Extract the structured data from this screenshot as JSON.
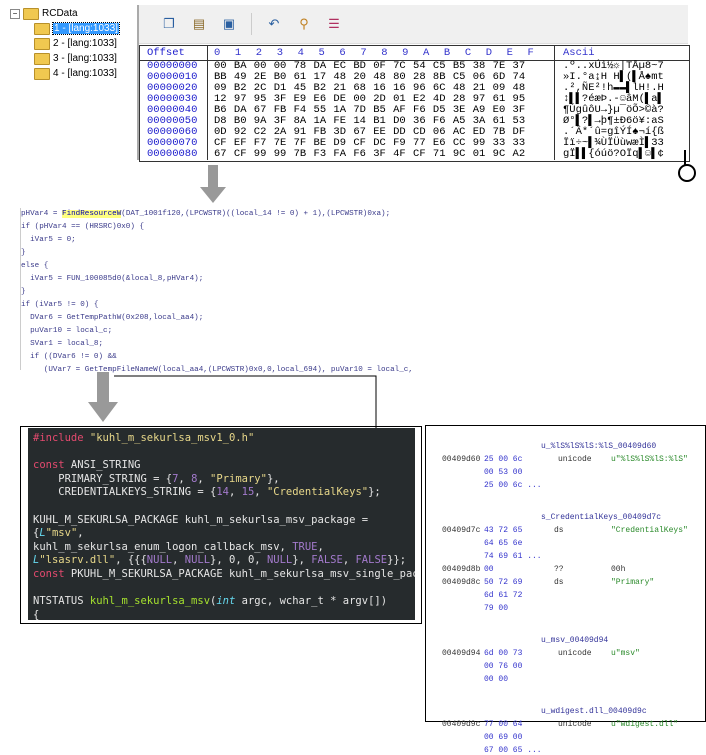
{
  "tree": {
    "root": "RCData",
    "items": [
      "1 - [lang:1033]",
      "2 - [lang:1033]",
      "3 - [lang:1033]",
      "4 - [lang:1033]"
    ],
    "selected": 0
  },
  "toolbar": {
    "icons": [
      "copy-icon",
      "paste-icon",
      "export-icon",
      "undo-icon",
      "find-icon",
      "hex-settings-icon"
    ]
  },
  "hex": {
    "header": {
      "offset": "Offset",
      "cols": "0  1  2  3  4  5  6  7  8  9  A  B  C  D  E  F",
      "ascii": "Ascii"
    },
    "rows": [
      {
        "off": "00000000",
        "hex": "00 BA 00 00 78 DA EC BD 0F 7C 54 C5 B5 38 7E 37",
        "ascii": ".º..xÚì½☼|TÅµ8~7"
      },
      {
        "off": "00000010",
        "hex": "BB 49 2E B0 61 17 48 20 48 80 28 8B C5 06 6D 74",
        "ascii": "»I.°a↨H H▌(▌Å♠mt"
      },
      {
        "off": "00000020",
        "hex": "09 B2 2C D1 45 B2 21 68 16 16 96 6C 48 21 09 48",
        "ascii": ".²,ÑE²!h▬▬▌lH!.H"
      },
      {
        "off": "00000030",
        "hex": "12 97 95 3F E9 E6 DE 00 2D 01 E2 4D 28 97 61 95",
        "ascii": "↕▌▌?éæÞ.-☺âM(▌a▌"
      },
      {
        "off": "00000040",
        "hex": "B6 DA 67 FB F4 55 1A 7D B5 AF F6 D5 3E A9 E0 3F",
        "ascii": "¶ÚgûôU→}µ¯öÕ>©à?"
      },
      {
        "off": "00000050",
        "hex": "D8 B0 9A 3F 8A 1A FE 14 B1 D0 36 F6 A5 3A 61 53",
        "ascii": "Ø°▌?▌→þ¶±Ð6ö¥:aS"
      },
      {
        "off": "00000060",
        "hex": "0D 92 C2 2A 91 FB 3D 67 EE DD CD 06 AC ED 7B DF",
        "ascii": ".´Â*´û=gîÝÍ♠¬í{ß"
      },
      {
        "off": "00000070",
        "hex": "CF EF F7 7E 7F BE D9 CF DC F9 77 E6 CC 99 33 33",
        "ascii": "Ïï÷~▌¾ÙÏÜùwæÌ▌33"
      },
      {
        "off": "00000080",
        "hex": "67 CF 99 99 7B F3 FA F6 3F 4F CF 71 9C 01 9C A2",
        "ascii": "gÏ▌▌{óúö?OÏq▌☺▌¢"
      }
    ]
  },
  "decompiled": [
    "pHVar4 = FindResourceW(DAT_1001f120,(LPCWSTR)((local_14 != 0) + 1),(LPCWSTR)0xa);",
    "if (pHVar4 == (HRSRC)0x0) {",
    "  iVar5 = 0;",
    "}",
    "else {",
    "  iVar5 = FUN_100085d0(&local_8,pHVar4);",
    "}",
    "if (iVar5 != 0) {",
    "  DVar6 = GetTempPathW(0x208,local_aa4);",
    "  puVar10 = local_c;",
    "  SVar1 = local_8;",
    "  if ((DVar6 != 0) &&",
    "     (UVar7 = GetTempFileNameW(local_aa4,(LPCWSTR)0x0,0,local_694), puVar10 = local_c,"
  ],
  "source": {
    "l1a": "#include",
    "l1b": " \"kuhl_m_sekurlsa_msv1_0.h\"",
    "l2a": "const",
    "l2b": " ANSI_STRING",
    "l3a": "    PRIMARY_STRING = {",
    "l3n1": "7",
    "l3c": ", ",
    "l3n2": "8",
    "l3d": ", ",
    "l3s": "\"Primary\"",
    "l3e": "},",
    "l4a": "    CREDENTIALKEYS_STRING = {",
    "l4n1": "14",
    "l4c": ", ",
    "l4n2": "15",
    "l4d": ", ",
    "l4s": "\"CredentialKeys\"",
    "l4e": "};",
    "l5": "KUHL_M_SEKURLSA_PACKAGE kuhl_m_sekurlsa_msv_package =",
    "l6a": "{",
    "l6b": "L",
    "l6s": "\"msv\"",
    "l6e": ",",
    "l7a": "kuhl_m_sekurlsa_enum_logon_callback_msv, ",
    "l7b": "TRUE",
    ",l7c": ",",
    "l8a": "L",
    "l8s": "\"lsasrv.dll\"",
    "l8b": ", {{{",
    "l8n1": "NULL",
    ",l8c": ", ",
    "l8n2": "NULL",
    "l8d": "}, 0, 0, ",
    "l8n3": "NULL",
    "l8e": "}, ",
    "l8n4": "FALSE",
    "l8f": ", ",
    "l8n5": "FALSE",
    "l8g": "}};",
    "l9a": "const",
    "l9b": " PKUHL_M_SEKURLSA_PACKAGE kuhl_m_sekurlsa_msv_single_pac",
    "l10a": "NTSTATUS ",
    "l10b": "kuhl_m_sekurlsa_msv",
    "l10c": "(",
    "l10d": "int",
    "l10e": " argc, wchar_t * argv[])",
    "l11": "{"
  },
  "listing": [
    {
      "label": "u_%lS%lS%lS:%lS_00409d60",
      "addr": "00409d60",
      "bytes": [
        "25 00 6c",
        "00 53 00",
        "25 00 6c ..."
      ],
      "type": "unicode",
      "value": "u\"%lS%lS%lS:%lS\""
    },
    {
      "label": "s_CredentialKeys_00409d7c",
      "addr": "00409d7c",
      "bytes": [
        "43 72 65",
        "64 65 6e",
        "74 69 61 ..."
      ],
      "type": "ds",
      "value": "\"CredentialKeys\""
    },
    {
      "label": "",
      "addr": "00409d8b",
      "bytes": [
        "00"
      ],
      "type": "??",
      "value": "00h"
    },
    {
      "label": "",
      "addr": "00409d8c",
      "bytes": [
        "50 72 69",
        "6d 61 72",
        "79 00"
      ],
      "type": "ds",
      "value": "\"Primary\""
    },
    {
      "label": "u_msv_00409d94",
      "addr": "00409d94",
      "bytes": [
        "6d 00 73",
        "00 76 00",
        "00 00"
      ],
      "type": "unicode",
      "value": "u\"msv\""
    },
    {
      "label": "u_wdigest.dll_00409d9c",
      "addr": "00409d9c",
      "bytes": [
        "77 00 64",
        "00 69 00",
        "67 00 65 ..."
      ],
      "type": "unicode",
      "value": "u\"wdigest.dll\""
    }
  ]
}
